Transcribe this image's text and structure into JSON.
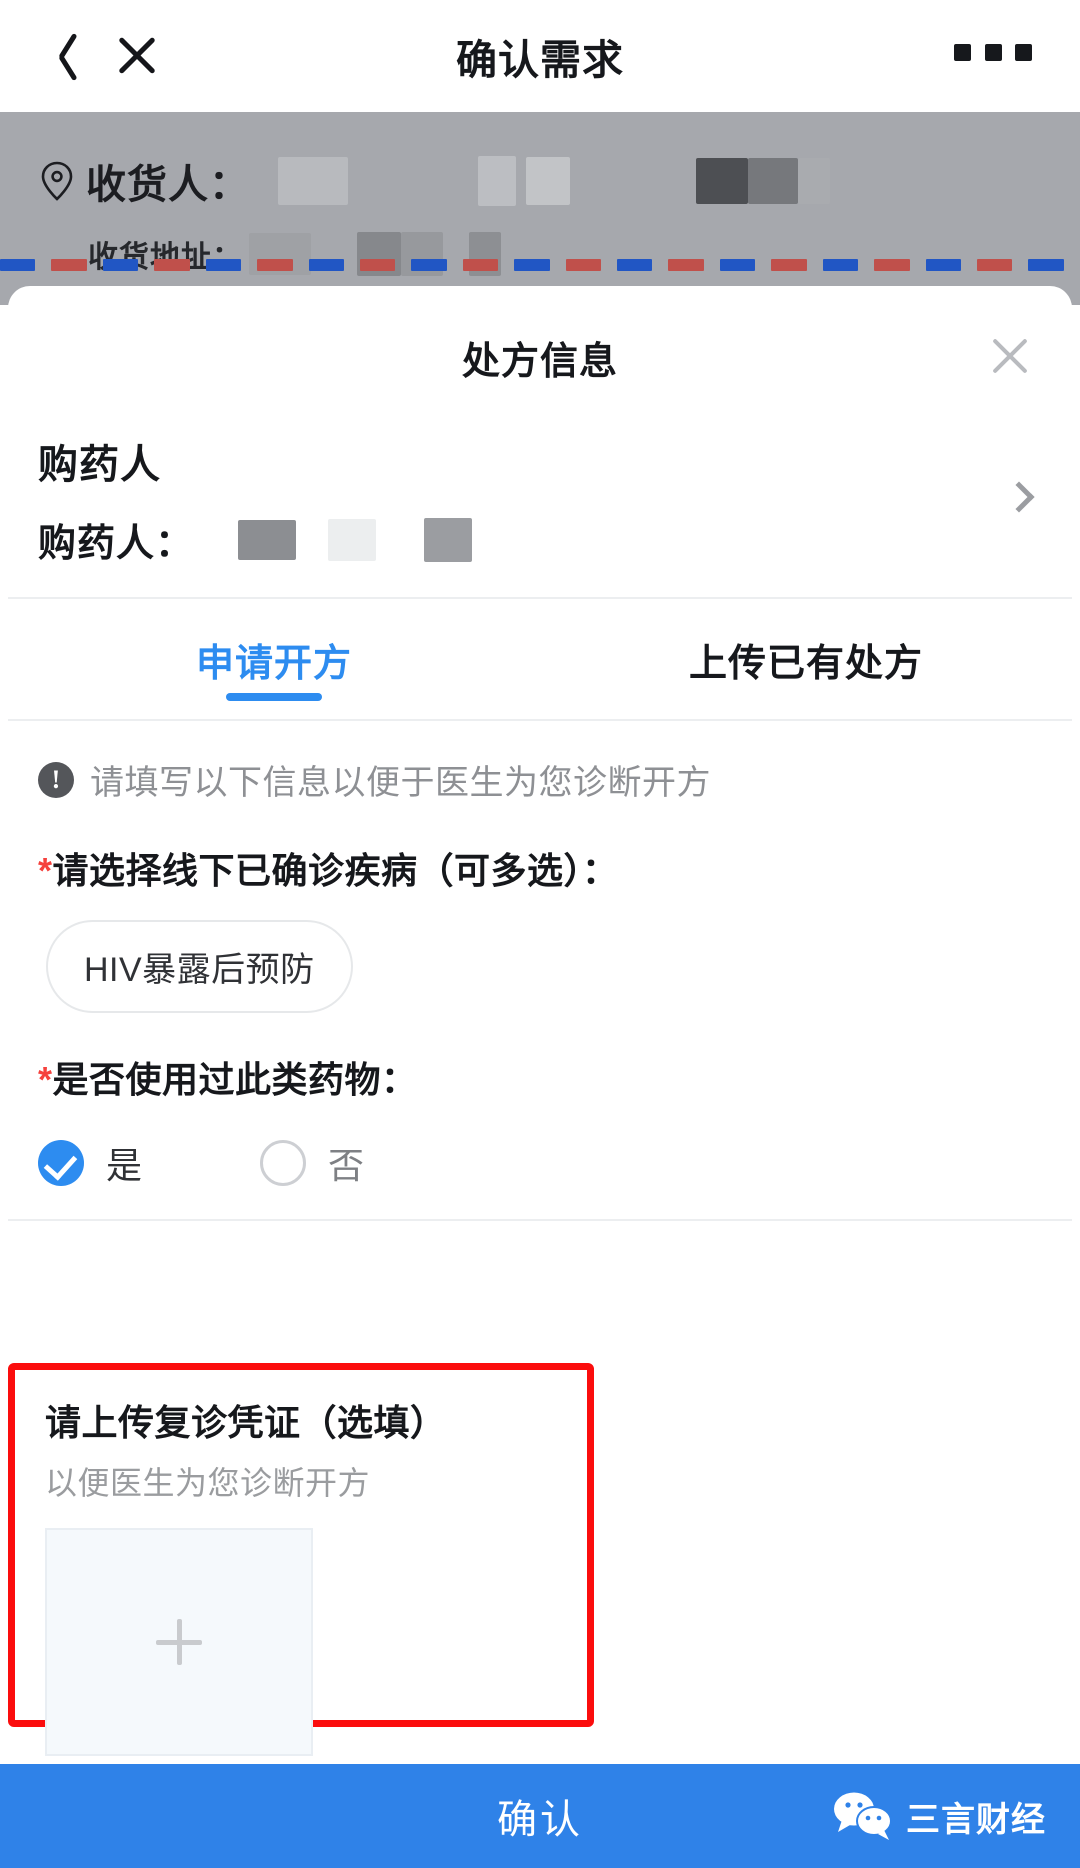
{
  "navbar": {
    "back_icon": "chevron-left-icon",
    "close_icon": "close-icon",
    "title": "确认需求",
    "more_icon": "more-horizontal-icon"
  },
  "address": {
    "pin_icon": "location-pin-icon",
    "recipient_label": "收货人：",
    "address_label": "收货地址：",
    "edit_icon": "edit-pencil-icon",
    "redacted": true
  },
  "divider": {
    "colors": [
      "#2156c4",
      "#c0504b"
    ],
    "dash_count": 21
  },
  "sheet": {
    "title": "处方信息",
    "close_icon": "close-icon"
  },
  "buyer": {
    "heading": "购药人",
    "label": "购药人：",
    "chevron_icon": "chevron-right-icon",
    "redacted": true
  },
  "tabs": [
    {
      "label": "申请开方",
      "active": true
    },
    {
      "label": "上传已有处方",
      "active": false
    }
  ],
  "form": {
    "notice_icon": "exclamation-circle-icon",
    "notice": "请填写以下信息以便于医生为您诊断开方",
    "disease_label": "请选择线下已确诊疾病（可多选）：",
    "disease_required": "*",
    "disease_chips": [
      "HIV暴露后预防"
    ],
    "used_drug_label": "是否使用过此类药物：",
    "used_drug_required": "*",
    "options": [
      {
        "label": "是",
        "selected": true
      },
      {
        "label": "否",
        "selected": false
      }
    ]
  },
  "upload": {
    "title": "请上传复诊凭证（选填）",
    "subtitle": "以便医生为您诊断开方",
    "add_icon": "plus-icon",
    "highlight_color": "#fb0d0d"
  },
  "confirm": {
    "label": "确认",
    "accent_color": "#2f82e8"
  },
  "watermark": {
    "logo_icon": "wechat-icon",
    "text": "三言财经"
  }
}
